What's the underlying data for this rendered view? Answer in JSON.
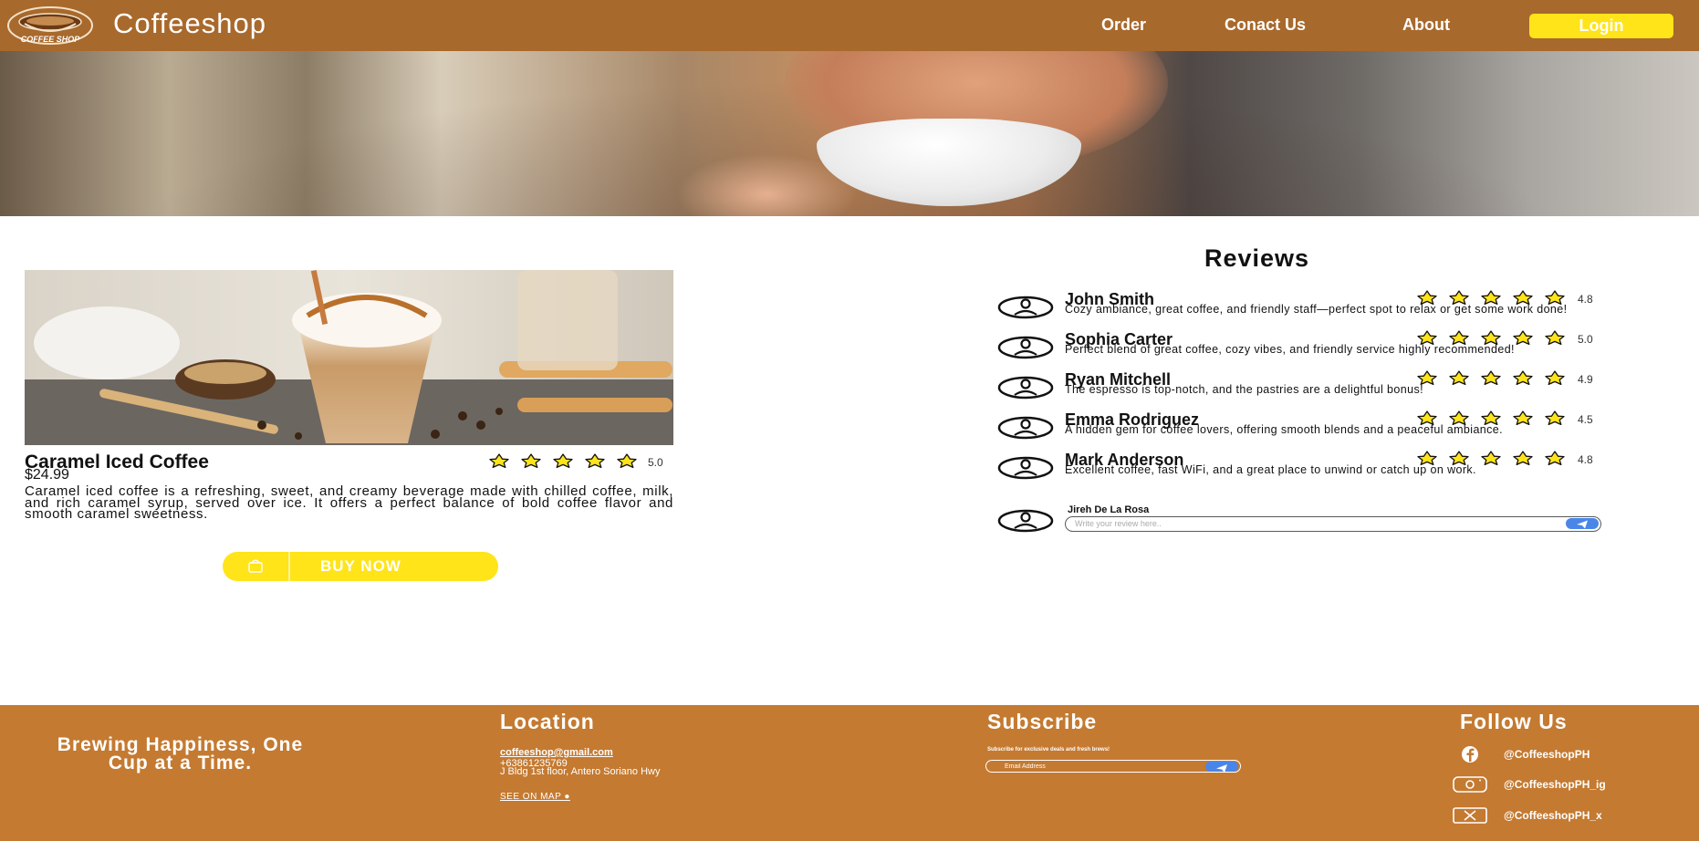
{
  "header": {
    "logo_text": "COFFEE SHOP",
    "brand": "Coffeeshop",
    "nav": [
      "Order",
      "Conact Us",
      "About"
    ],
    "login_label": "Login"
  },
  "product": {
    "name": "Caramel Iced Coffee",
    "price": "$24.99",
    "stars": 5,
    "rating": "5.0",
    "description": "Caramel iced coffee is a refreshing, sweet, and creamy beverage made with chilled coffee, milk, and rich caramel syrup, served over ice. It offers a perfect balance of bold coffee flavor and smooth caramel sweetness.",
    "buy_label": "BUY NOW"
  },
  "reviews": {
    "title": "Reviews",
    "items": [
      {
        "name": "John Smith",
        "stars": 5,
        "rating": "4.8",
        "text": "Cozy ambiance, great coffee, and friendly staff—perfect spot to relax or get some work done!"
      },
      {
        "name": "Sophia Carter",
        "stars": 5,
        "rating": "5.0",
        "text": "Perfect blend of great coffee, cozy vibes, and friendly service highly recommended!"
      },
      {
        "name": "Ryan Mitchell",
        "stars": 5,
        "rating": "4.9",
        "text": "The espresso is top-notch, and the pastries are a delightful bonus!"
      },
      {
        "name": "Emma Rodriguez",
        "stars": 5,
        "rating": "4.5",
        "text": "A hidden gem for coffee lovers, offering smooth blends and a peaceful ambiance."
      },
      {
        "name": "Mark Anderson",
        "stars": 5,
        "rating": "4.8",
        "text": "Excellent coffee, fast WiFi, and a great place to unwind or catch up on work."
      }
    ],
    "compose": {
      "user": "Jireh De La Rosa",
      "placeholder": "Write your review here.."
    }
  },
  "footer": {
    "tagline": "Brewing Happiness, One Cup at a Time.",
    "location": {
      "heading": "Location",
      "email": "coffeeshop@gmail.com",
      "phone": "+63861235769",
      "address": "J Bldg 1st floor, Antero Soriano Hwy",
      "map_link": "SEE ON MAP"
    },
    "subscribe": {
      "heading": "Subscribe",
      "note": "Subscribe for exclusive deals and fresh brews!",
      "placeholder": "Email Address"
    },
    "follow": {
      "heading": "Follow Us",
      "items": [
        {
          "icon": "facebook-icon",
          "label": "@CoffeeshopPH"
        },
        {
          "icon": "instagram-icon",
          "label": "@CoffeeshopPH_ig"
        },
        {
          "icon": "x-icon",
          "label": "@CoffeeshopPH_x"
        }
      ]
    }
  },
  "colors": {
    "header_bg": "#a8692c",
    "footer_bg": "#c47a31",
    "accent_yellow": "#ffe41a",
    "send_blue": "#4a86e8"
  }
}
